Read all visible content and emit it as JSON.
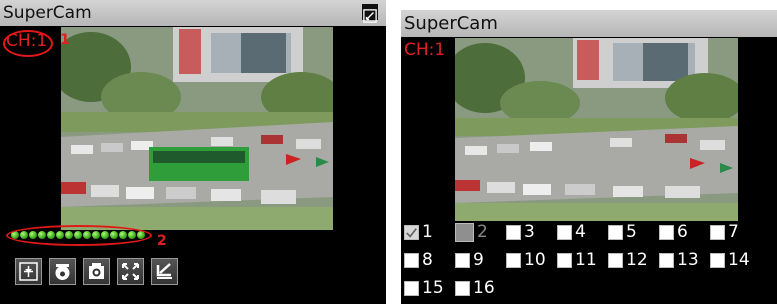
{
  "left": {
    "app_title": "SuperCam",
    "channel_label": "CH:1",
    "annotation_1": "1",
    "annotation_2": "2",
    "indicator_count": 15,
    "toolbar": [
      {
        "name": "tool-snapshot-frame-button",
        "icon": "frame-icon"
      },
      {
        "name": "tool-ptz-button",
        "icon": "dome-camera-icon"
      },
      {
        "name": "tool-camera-button",
        "icon": "camera-icon"
      },
      {
        "name": "tool-fullscreen-button",
        "icon": "expand-icon"
      },
      {
        "name": "tool-zoom-button",
        "icon": "corner-arrow-icon"
      }
    ]
  },
  "right": {
    "app_title": "SuperCam",
    "channel_label": "CH:1",
    "channels": [
      [
        "1",
        "2",
        "3",
        "4",
        "5",
        "6",
        "7"
      ],
      [
        "8",
        "9",
        "10",
        "11",
        "12",
        "13",
        "14"
      ],
      [
        "15",
        "16"
      ]
    ],
    "checked_channel": "1",
    "selected_channel": "2"
  },
  "colors": {
    "accent_red": "#e02020",
    "titlebar": "#c4c4c4",
    "indicator_green": "#3ab818"
  }
}
